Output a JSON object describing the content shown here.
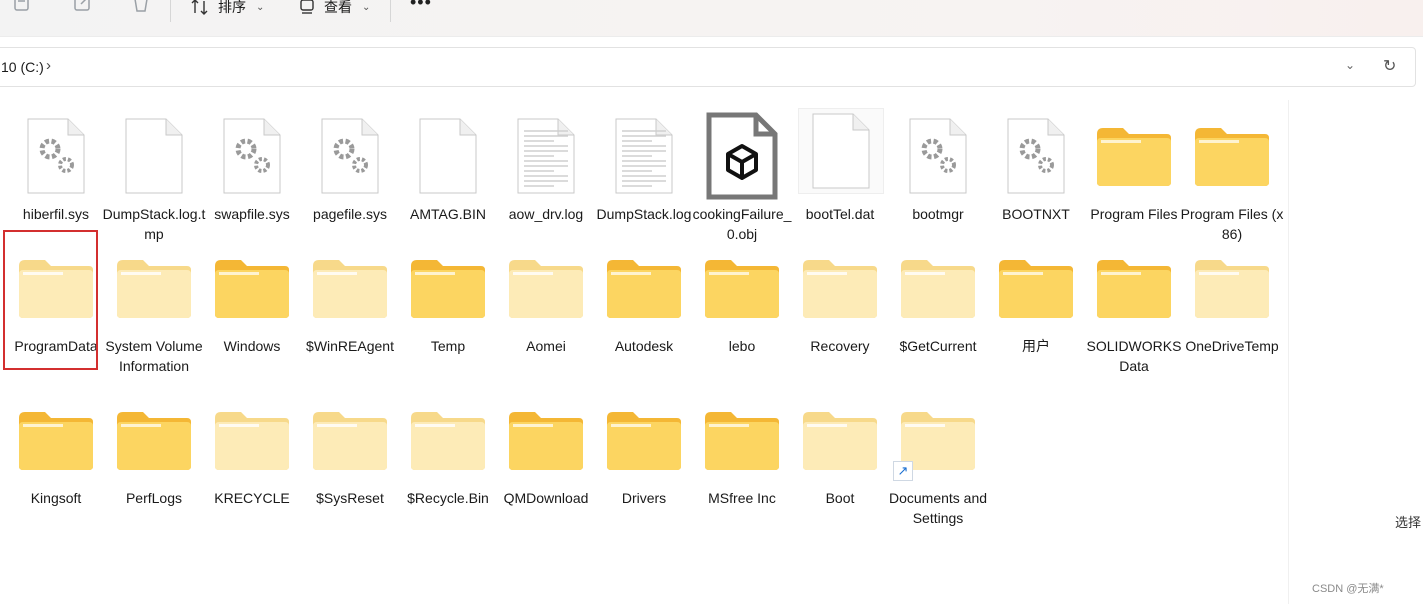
{
  "toolbar": {
    "sort_label": "排序",
    "view_label": "查看",
    "more_label": "•••"
  },
  "address": {
    "path": "10 (C:)",
    "separator": "›"
  },
  "right_panel": {
    "select_label": "选择"
  },
  "watermark": "CSDN @无满*",
  "colors": {
    "folder": "#f7c948",
    "folder_light": "#fbe3a1",
    "selection": "#d32f2f"
  },
  "rows": [
    [
      {
        "name": "hiberfil.sys",
        "icon": "sys-file-icon"
      },
      {
        "name": "DumpStack.log.tmp",
        "icon": "blank-file-icon"
      },
      {
        "name": "swapfile.sys",
        "icon": "sys-file-icon"
      },
      {
        "name": "pagefile.sys",
        "icon": "sys-file-icon"
      },
      {
        "name": "AMTAG.BIN",
        "icon": "blank-file-icon"
      },
      {
        "name": "aow_drv.log",
        "icon": "text-file-icon"
      },
      {
        "name": "DumpStack.log",
        "icon": "text-file-icon"
      },
      {
        "name": "cookingFailure_0.obj",
        "icon": "3d-object-icon"
      },
      {
        "name": "bootTel.dat",
        "icon": "blank-file-icon"
      },
      {
        "name": "bootmgr",
        "icon": "sys-file-icon"
      },
      {
        "name": "BOOTNXT",
        "icon": "sys-file-icon"
      },
      {
        "name": "Program Files",
        "icon": "folder-icon"
      },
      {
        "name": "Program Files (x86)",
        "icon": "folder-icon"
      }
    ],
    [
      {
        "name": "ProgramData",
        "icon": "folder-light-icon"
      },
      {
        "name": "System Volume Information",
        "icon": "folder-light-icon"
      },
      {
        "name": "Windows",
        "icon": "folder-icon"
      },
      {
        "name": "$WinREAgent",
        "icon": "folder-light-icon"
      },
      {
        "name": "Temp",
        "icon": "folder-icon"
      },
      {
        "name": "Aomei",
        "icon": "folder-light-icon"
      },
      {
        "name": "Autodesk",
        "icon": "folder-icon"
      },
      {
        "name": "lebo",
        "icon": "folder-icon"
      },
      {
        "name": "Recovery",
        "icon": "folder-light-icon"
      },
      {
        "name": "$GetCurrent",
        "icon": "folder-light-icon"
      },
      {
        "name": "用户",
        "icon": "folder-icon"
      },
      {
        "name": "SOLIDWORKS Data",
        "icon": "folder-icon"
      },
      {
        "name": "OneDriveTemp",
        "icon": "folder-light-icon"
      }
    ],
    [
      {
        "name": "Kingsoft",
        "icon": "folder-icon"
      },
      {
        "name": "PerfLogs",
        "icon": "folder-icon"
      },
      {
        "name": "KRECYCLE",
        "icon": "folder-light-icon"
      },
      {
        "name": "$SysReset",
        "icon": "folder-light-icon"
      },
      {
        "name": "$Recycle.Bin",
        "icon": "folder-light-icon"
      },
      {
        "name": "QMDownload",
        "icon": "folder-icon"
      },
      {
        "name": "Drivers",
        "icon": "folder-icon"
      },
      {
        "name": "MSfree Inc",
        "icon": "folder-icon"
      },
      {
        "name": "Boot",
        "icon": "folder-light-icon"
      },
      {
        "name": "Documents and Settings",
        "icon": "folder-light-icon"
      }
    ]
  ]
}
